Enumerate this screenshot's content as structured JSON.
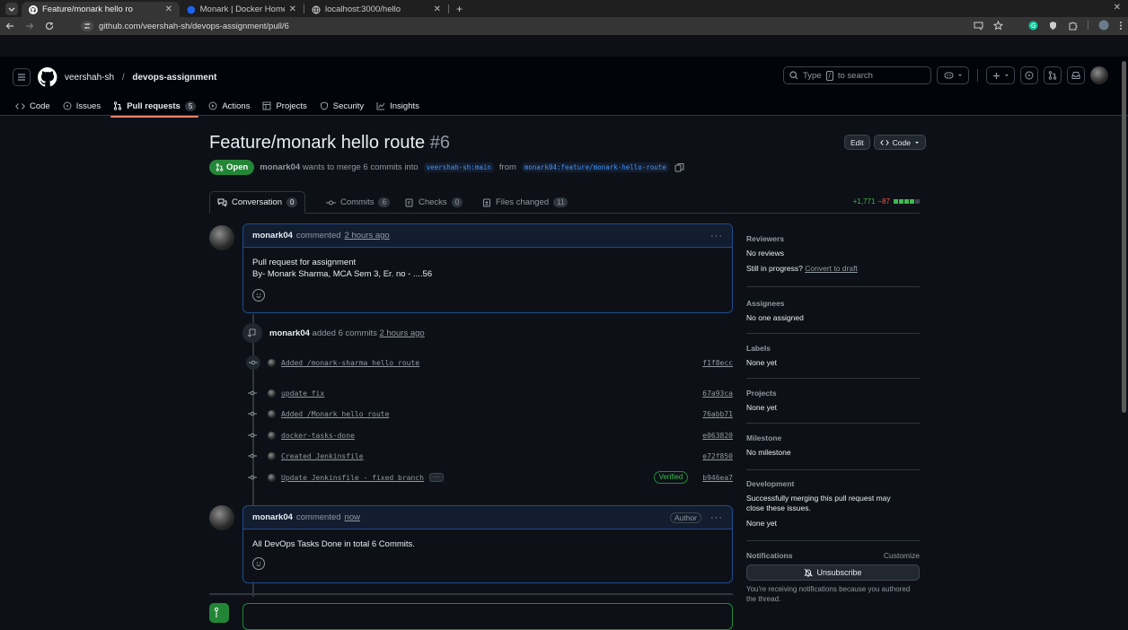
{
  "browser": {
    "tabs": [
      {
        "title": "Feature/monark hello ro",
        "active": true
      },
      {
        "title": "Monark | Docker Home",
        "active": false
      },
      {
        "title": "localhost:3000/hello",
        "active": false
      }
    ],
    "url": "github.com/veershah-sh/devops-assignment/pull/6"
  },
  "github": {
    "owner": "veershah-sh",
    "repo": "devops-assignment",
    "search_placeholder": "Type",
    "search_key": "/",
    "search_suffix": "to search",
    "repo_tabs": [
      {
        "label": "Code"
      },
      {
        "label": "Issues"
      },
      {
        "label": "Pull requests",
        "count": "5"
      },
      {
        "label": "Actions"
      },
      {
        "label": "Projects"
      },
      {
        "label": "Security"
      },
      {
        "label": "Insights"
      }
    ]
  },
  "pr": {
    "title": "Feature/monark hello route",
    "number": "#6",
    "edit_label": "Edit",
    "code_label": "Code",
    "status": "Open",
    "author": "monark04",
    "meta_text": "wants to merge 6 commits into",
    "base_branch": "veershah-sh:main",
    "from_text": "from",
    "head_branch": "monark04:feature/monark-hello-route",
    "tabs": [
      {
        "label": "Conversation",
        "count": "0"
      },
      {
        "label": "Commits",
        "count": "6"
      },
      {
        "label": "Checks",
        "count": "0"
      },
      {
        "label": "Files changed",
        "count": "11"
      }
    ],
    "additions": "+1,771",
    "deletions": "−87"
  },
  "comment1": {
    "author": "monark04",
    "verb": "commented",
    "time": "2 hours ago",
    "line1": "Pull request for assignment",
    "line2": "By- Monark Sharma, MCA Sem 3, Er. no - ....56"
  },
  "commits_event": {
    "author": "monark04",
    "text": "added 6 commits",
    "time": "2 hours ago"
  },
  "commits": [
    {
      "message": "Added /monark-sharma hello route",
      "sha": "f1f8ecc"
    },
    {
      "message": "update fix",
      "sha": "67a93ca"
    },
    {
      "message": "Added /Monark hello route",
      "sha": "76abb71"
    },
    {
      "message": "docker-tasks-done",
      "sha": "e063820"
    },
    {
      "message": "Created Jenkinsfile",
      "sha": "e72f850"
    },
    {
      "message": "Update Jenkinsfile - fixed branch",
      "sha": "b946ea7",
      "verified": "Verified"
    }
  ],
  "comment2": {
    "author": "monark04",
    "verb": "commented",
    "time": "now",
    "badge": "Author",
    "body": "All DevOps Tasks Done in total 6 Commits."
  },
  "sidebar": {
    "reviewers_h": "Reviewers",
    "reviewers_v": "No reviews",
    "progress_text": "Still in progress?",
    "progress_link": "Convert to draft",
    "assignees_h": "Assignees",
    "assignees_v": "No one assigned",
    "labels_h": "Labels",
    "labels_v": "None yet",
    "projects_h": "Projects",
    "projects_v": "None yet",
    "milestone_h": "Milestone",
    "milestone_v": "No milestone",
    "development_h": "Development",
    "development_text": "Successfully merging this pull request may close these issues.",
    "development_v": "None yet",
    "notifications_h": "Notifications",
    "customize": "Customize",
    "unsubscribe": "Unsubscribe",
    "notif_text": "You're receiving notifications because you authored the thread."
  }
}
